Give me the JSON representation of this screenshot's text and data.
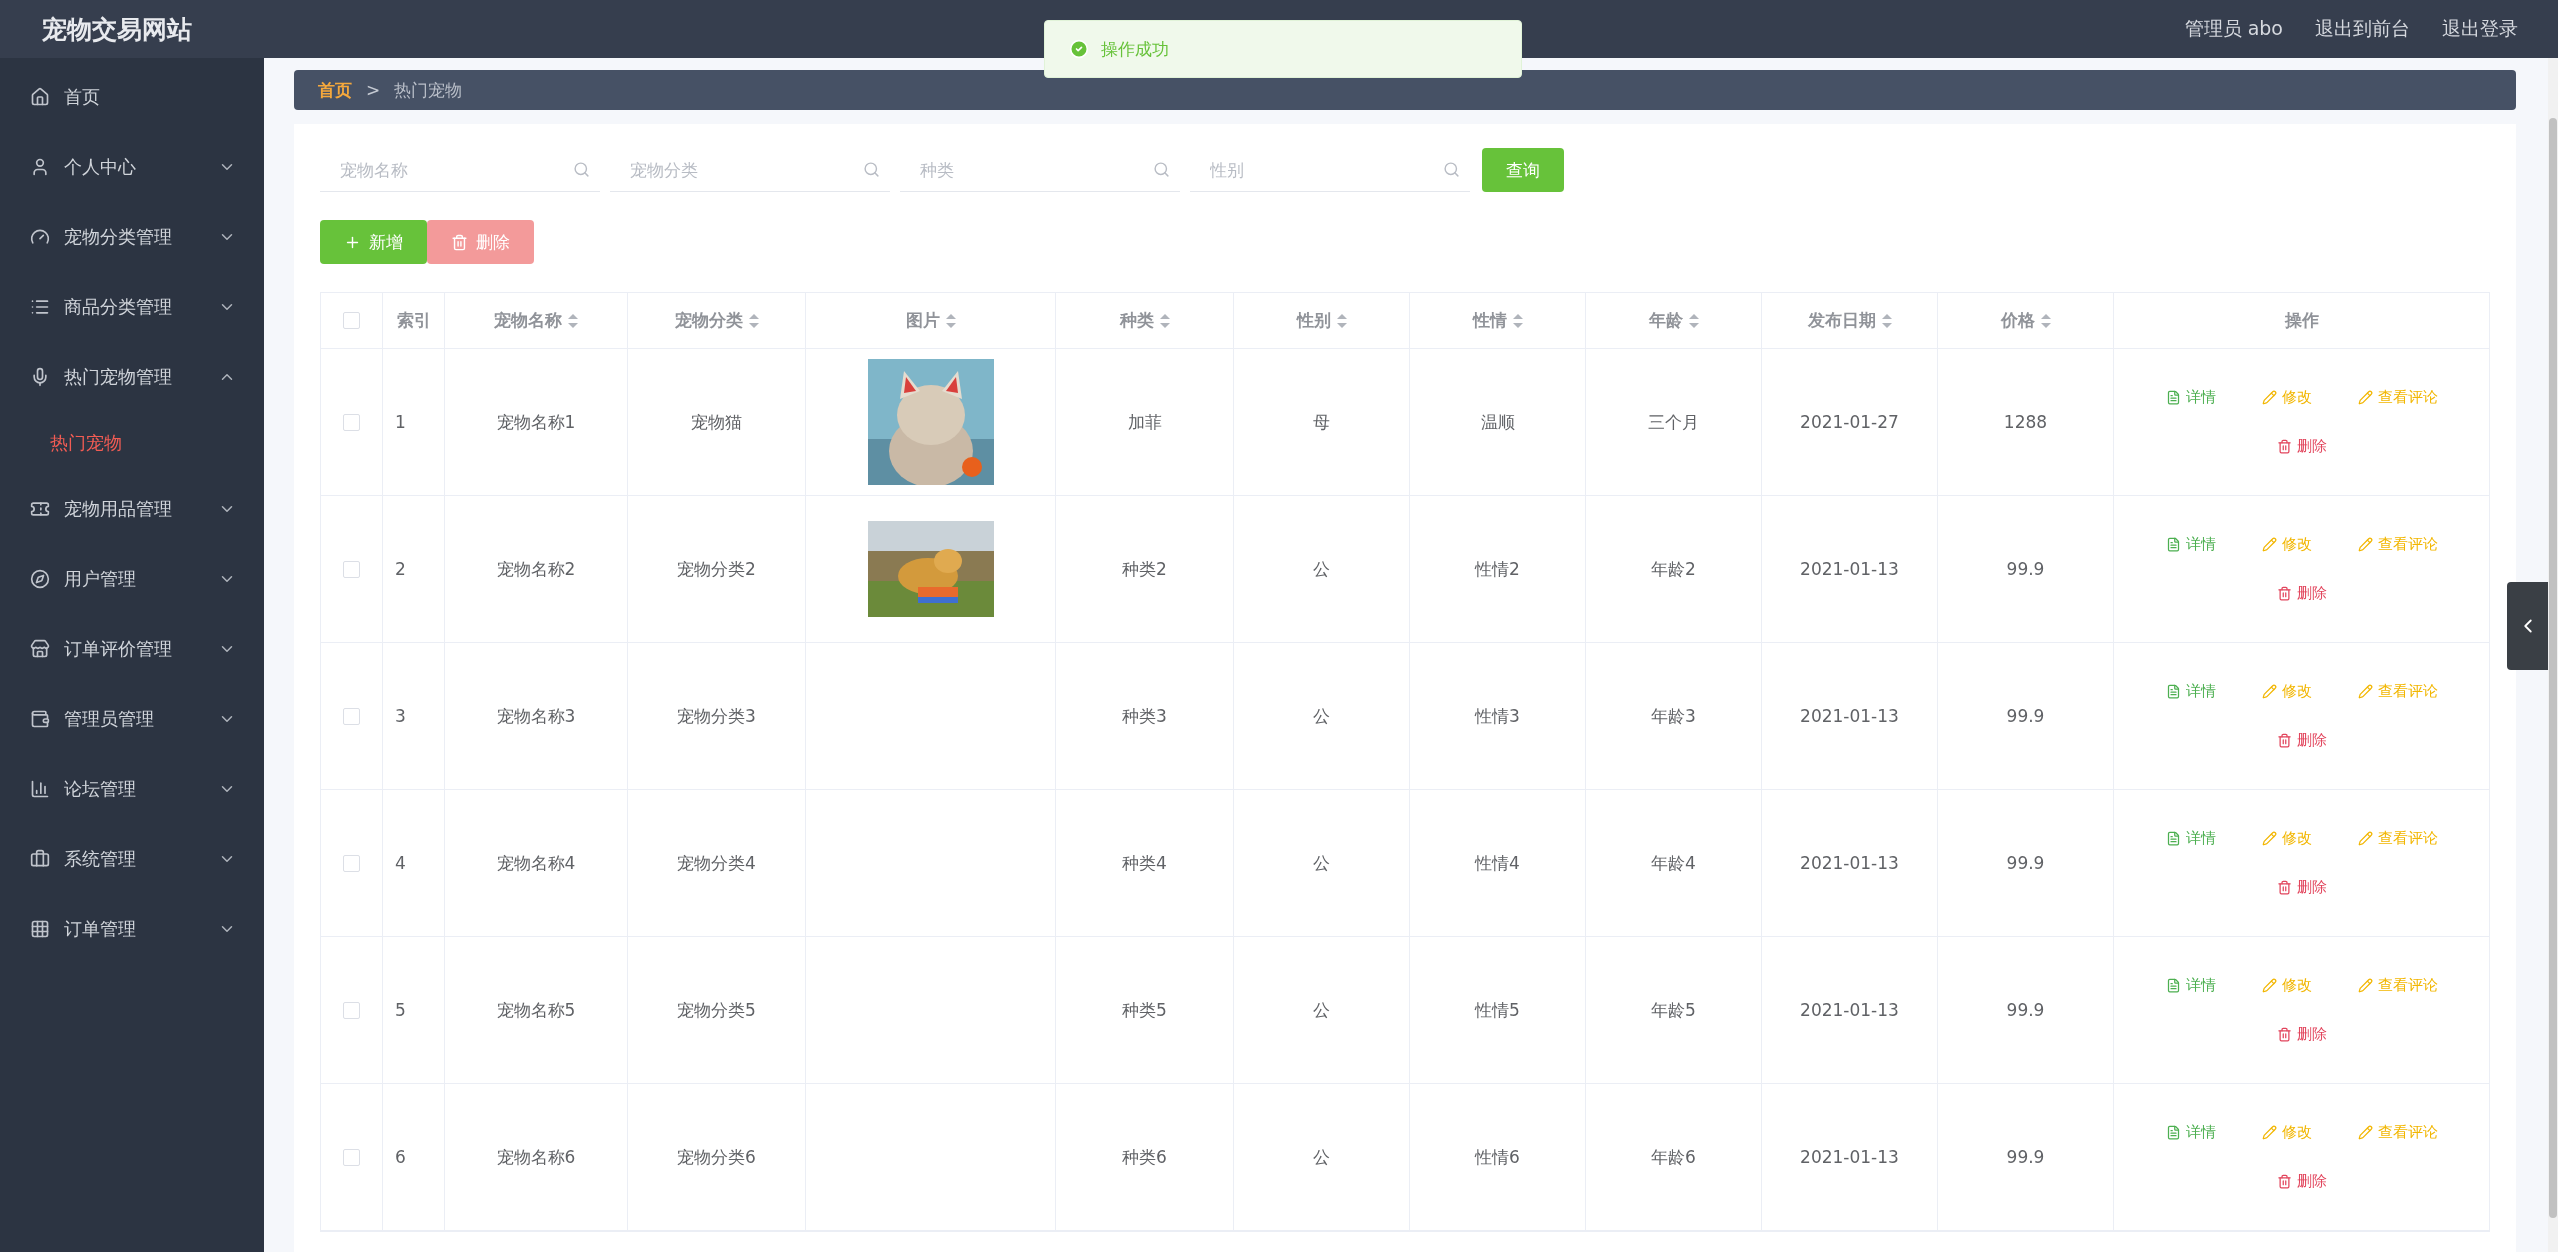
{
  "header": {
    "title": "宠物交易网站",
    "user": "管理员 abo",
    "links": [
      "退出到前台",
      "退出登录"
    ]
  },
  "toast": {
    "message": "操作成功",
    "kind": "success"
  },
  "sidebar": {
    "items": [
      {
        "label": "首页"
      },
      {
        "label": "个人中心",
        "expanded": false
      },
      {
        "label": "宠物分类管理",
        "expanded": false
      },
      {
        "label": "商品分类管理",
        "expanded": false
      },
      {
        "label": "热门宠物管理",
        "expanded": true,
        "children": [
          {
            "label": "热门宠物",
            "selected": true
          }
        ]
      },
      {
        "label": "宠物用品管理",
        "expanded": false
      },
      {
        "label": "用户管理",
        "expanded": false
      },
      {
        "label": "订单评价管理",
        "expanded": false
      },
      {
        "label": "管理员管理",
        "expanded": false
      },
      {
        "label": "论坛管理",
        "expanded": false
      },
      {
        "label": "系统管理",
        "expanded": false
      },
      {
        "label": "订单管理",
        "expanded": false
      }
    ]
  },
  "breadcrumb": {
    "home": "首页",
    "separator": ">",
    "current": "热门宠物"
  },
  "filters": [
    {
      "placeholder": "宠物名称"
    },
    {
      "placeholder": "宠物分类"
    },
    {
      "placeholder": "种类"
    },
    {
      "placeholder": "性别"
    }
  ],
  "search_button": "查询",
  "toolbar": [
    {
      "label": "新增",
      "kind": "add",
      "disabled": false
    },
    {
      "label": "删除",
      "kind": "delete",
      "disabled": true
    }
  ],
  "table": {
    "header_checked": false,
    "columns": [
      {
        "label": "索引",
        "kind": "text",
        "sortable": false
      },
      {
        "label": "宠物名称",
        "kind": "text",
        "sortable": true
      },
      {
        "label": "宠物分类",
        "kind": "text",
        "sortable": true
      },
      {
        "label": "图片",
        "sortable": true
      },
      {
        "label": "种类",
        "kind": "text",
        "sortable": true
      },
      {
        "label": "性别",
        "kind": "text",
        "sortable": true
      },
      {
        "label": "性情",
        "kind": "text",
        "sortable": true
      },
      {
        "label": "年龄",
        "kind": "text",
        "sortable": true
      },
      {
        "label": "发布日期",
        "kind": "text",
        "sortable": true
      },
      {
        "label": "价格",
        "kind": "text",
        "sortable": true
      },
      {
        "label": "操作",
        "kind": "actions",
        "sortable": false
      }
    ],
    "rows": [
      {
        "checked": false,
        "cells": [
          "1",
          "宠物名称1",
          "宠物猫",
          "",
          "加菲",
          "母",
          "温顺",
          "三个月",
          "2021-01-27",
          "1288"
        ],
        "image": {
          "kind": "picture"
        },
        "actions": [
          {
            "label": "详情",
            "kind": "detail"
          },
          {
            "label": "修改",
            "kind": "edit"
          },
          {
            "label": "查看评论",
            "kind": "comment"
          },
          {
            "label": "删除",
            "kind": "delete"
          }
        ]
      },
      {
        "checked": false,
        "cells": [
          "2",
          "宠物名称2",
          "宠物分类2",
          "",
          "种类2",
          "公",
          "性情2",
          "年龄2",
          "2021-01-13",
          "99.9"
        ],
        "image": {
          "kind": "picture"
        },
        "actions": [
          {
            "label": "详情",
            "kind": "detail"
          },
          {
            "label": "修改",
            "kind": "edit"
          },
          {
            "label": "查看评论",
            "kind": "comment"
          },
          {
            "label": "删除",
            "kind": "delete"
          }
        ]
      },
      {
        "checked": false,
        "cells": [
          "3",
          "宠物名称3",
          "宠物分类3",
          "",
          "种类3",
          "公",
          "性情3",
          "年龄3",
          "2021-01-13",
          "99.9"
        ],
        "actions": [
          {
            "label": "详情",
            "kind": "detail"
          },
          {
            "label": "修改",
            "kind": "edit"
          },
          {
            "label": "查看评论",
            "kind": "comment"
          },
          {
            "label": "删除",
            "kind": "delete"
          }
        ]
      },
      {
        "checked": false,
        "cells": [
          "4",
          "宠物名称4",
          "宠物分类4",
          "",
          "种类4",
          "公",
          "性情4",
          "年龄4",
          "2021-01-13",
          "99.9"
        ],
        "actions": [
          {
            "label": "详情",
            "kind": "detail"
          },
          {
            "label": "修改",
            "kind": "edit"
          },
          {
            "label": "查看评论",
            "kind": "comment"
          },
          {
            "label": "删除",
            "kind": "delete"
          }
        ]
      },
      {
        "checked": false,
        "cells": [
          "5",
          "宠物名称5",
          "宠物分类5",
          "",
          "种类5",
          "公",
          "性情5",
          "年龄5",
          "2021-01-13",
          "99.9"
        ],
        "actions": [
          {
            "label": "详情",
            "kind": "detail"
          },
          {
            "label": "修改",
            "kind": "edit"
          },
          {
            "label": "查看评论",
            "kind": "comment"
          },
          {
            "label": "删除",
            "kind": "delete"
          }
        ]
      },
      {
        "checked": false,
        "cells": [
          "6",
          "宠物名称6",
          "宠物分类6",
          "",
          "种类6",
          "公",
          "性情6",
          "年龄6",
          "2021-01-13",
          "99.9"
        ],
        "actions": [
          {
            "label": "详情",
            "kind": "detail"
          },
          {
            "label": "修改",
            "kind": "edit"
          },
          {
            "label": "查看评论",
            "kind": "comment"
          },
          {
            "label": "删除",
            "kind": "delete"
          }
        ]
      }
    ]
  }
}
